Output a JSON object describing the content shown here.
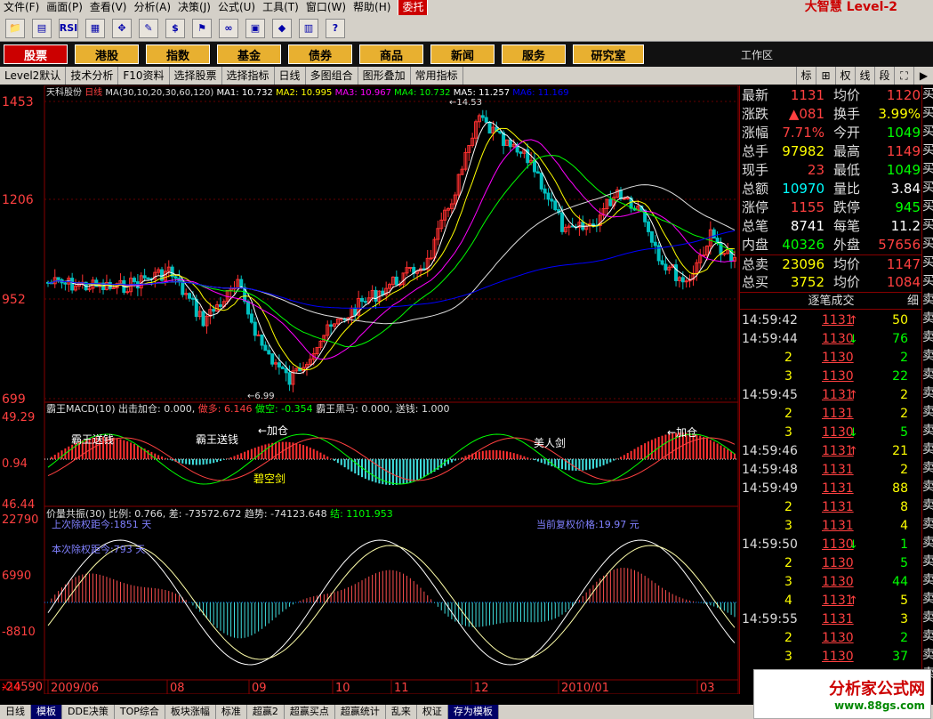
{
  "menu": [
    "文件(F)",
    "画面(P)",
    "查看(V)",
    "分析(A)",
    "决策(J)",
    "公式(U)",
    "工具(T)",
    "窗口(W)",
    "帮助(H)",
    "委托"
  ],
  "brand": "大智慧 Level-2",
  "toolbar_icons": [
    "open-icon",
    "chart-icon",
    "rsi-icon",
    "grid-icon",
    "move-icon",
    "ruler-icon",
    "dollar-icon",
    "flag-icon",
    "binoculars-icon",
    "calc-icon",
    "diamond-icon",
    "table-icon",
    "help-icon"
  ],
  "nav": [
    "股票",
    "港股",
    "指数",
    "基金",
    "债券",
    "商品",
    "新闻",
    "服务",
    "研究室"
  ],
  "workspace": "工作区",
  "tabs": [
    "Level2默认",
    "技术分析",
    "F10资料",
    "选择股票",
    "选择指标",
    "日线",
    "多图组合",
    "图形叠加",
    "常用指标"
  ],
  "right_tabs": [
    "标",
    "⊞",
    "权",
    "线",
    "段",
    "⛶",
    "▶"
  ],
  "chart": {
    "title": "天科股份",
    "period": "日线",
    "ma_params": "MA(30,10,20,30,60,120)",
    "ma": [
      {
        "label": "MA1: 10.732",
        "color": "#ffffff"
      },
      {
        "label": "MA2: 10.995",
        "color": "#ffff00"
      },
      {
        "label": "MA3: 10.967",
        "color": "#ff00ff"
      },
      {
        "label": "MA4: 10.732",
        "color": "#00ff00"
      },
      {
        "label": "MA5: 11.257",
        "color": "#ffffff"
      },
      {
        "label": "MA6: 11.169",
        "color": "#0000ff"
      }
    ],
    "price_ticks": [
      "1453",
      "1206",
      "952",
      "699"
    ],
    "high_label": "14.53",
    "low_label": "6.99",
    "macd_title": "霸王MACD(10) 出击加仓: 0.000,",
    "macd_buy": "做多: 6.146",
    "macd_sell": "做空: -0.354",
    "macd_black": "霸王黑马: 0.000,",
    "macd_send": "送钱: 1.000",
    "macd_ticks": [
      "49.29",
      "0.94",
      "46.44"
    ],
    "macd_notes": [
      "霸王送钱",
      "霸王送钱",
      "←加仓",
      "碧空剑",
      "美人剑",
      "←加仓"
    ],
    "vol_title": "价量共振(30) 比例: 0.766, 差: -73572.672",
    "vol_trend": "趋势: -74123.648",
    "vol_end": "结: 1101.953",
    "vol_ticks": [
      "22790",
      "6990",
      "-8810",
      "-24590"
    ],
    "vol_notes": [
      "上次除权距今:1851 天",
      "本次除权距今:793 天",
      "当前复权价格:19.97 元"
    ],
    "x_ticks": [
      "2009/06",
      "08",
      "09",
      "10",
      "11",
      "12",
      "2010/01",
      "03"
    ],
    "x10": "X10"
  },
  "quote": [
    {
      "l1": "最新",
      "v1": "1131",
      "c1": "#ff4040",
      "l2": "均价",
      "v2": "1120",
      "c2": "#ff4040"
    },
    {
      "l1": "涨跌",
      "v1": "▲081",
      "c1": "#ff4040",
      "l2": "换手",
      "v2": "3.99%",
      "c2": "#ffff00"
    },
    {
      "l1": "涨幅",
      "v1": "7.71%",
      "c1": "#ff4040",
      "l2": "今开",
      "v2": "1049",
      "c2": "#00ff00"
    },
    {
      "l1": "总手",
      "v1": "97982",
      "c1": "#ffff00",
      "l2": "最高",
      "v2": "1149",
      "c2": "#ff4040"
    },
    {
      "l1": "现手",
      "v1": "23",
      "c1": "#ff4040",
      "l2": "最低",
      "v2": "1049",
      "c2": "#00ff00"
    },
    {
      "l1": "总额",
      "v1": "10970",
      "c1": "#00ffff",
      "l2": "量比",
      "v2": "3.84",
      "c2": "#ffffff"
    },
    {
      "l1": "涨停",
      "v1": "1155",
      "c1": "#ff4040",
      "l2": "跌停",
      "v2": "945",
      "c2": "#00ff00"
    },
    {
      "l1": "总笔",
      "v1": "8741",
      "c1": "#ffffff",
      "l2": "每笔",
      "v2": "11.2",
      "c2": "#ffffff"
    },
    {
      "l1": "内盘",
      "v1": "40326",
      "c1": "#00ff00",
      "l2": "外盘",
      "v2": "57656",
      "c2": "#ff4040"
    },
    {
      "l1": "总卖",
      "v1": "23096",
      "c1": "#ffff00",
      "l2": "均价",
      "v2": "1147",
      "c2": "#ff4040"
    },
    {
      "l1": "总买",
      "v1": "3752",
      "c1": "#ffff00",
      "l2": "均价",
      "v2": "1084",
      "c2": "#ff4040"
    }
  ],
  "ticks_title": "逐笔成交",
  "ticks_flag": "细",
  "ticks": [
    {
      "t": "14:59:42",
      "p": "1131",
      "a": "↑",
      "v": "50",
      "pc": "#ff4040",
      "vc": "#ffff00"
    },
    {
      "t": "14:59:44",
      "p": "1130",
      "a": "↓",
      "v": "76",
      "pc": "#ff4040",
      "vc": "#00ff00"
    },
    {
      "t": "2",
      "p": "1130",
      "a": "",
      "v": "2",
      "pc": "#ff4040",
      "vc": "#00ff00"
    },
    {
      "t": "3",
      "p": "1130",
      "a": "",
      "v": "22",
      "pc": "#ff4040",
      "vc": "#00ff00"
    },
    {
      "t": "14:59:45",
      "p": "1131",
      "a": "↑",
      "v": "2",
      "pc": "#ff4040",
      "vc": "#ffff00"
    },
    {
      "t": "2",
      "p": "1131",
      "a": "",
      "v": "2",
      "pc": "#ff4040",
      "vc": "#ffff00"
    },
    {
      "t": "3",
      "p": "1130",
      "a": "↓",
      "v": "5",
      "pc": "#ff4040",
      "vc": "#00ff00"
    },
    {
      "t": "14:59:46",
      "p": "1131",
      "a": "↑",
      "v": "21",
      "pc": "#ff4040",
      "vc": "#ffff00"
    },
    {
      "t": "14:59:48",
      "p": "1131",
      "a": "",
      "v": "2",
      "pc": "#ff4040",
      "vc": "#ffff00"
    },
    {
      "t": "14:59:49",
      "p": "1131",
      "a": "",
      "v": "88",
      "pc": "#ff4040",
      "vc": "#ffff00"
    },
    {
      "t": "2",
      "p": "1131",
      "a": "",
      "v": "8",
      "pc": "#ff4040",
      "vc": "#ffff00"
    },
    {
      "t": "3",
      "p": "1131",
      "a": "",
      "v": "4",
      "pc": "#ff4040",
      "vc": "#ffff00"
    },
    {
      "t": "14:59:50",
      "p": "1130",
      "a": "↓",
      "v": "1",
      "pc": "#ff4040",
      "vc": "#00ff00"
    },
    {
      "t": "2",
      "p": "1130",
      "a": "",
      "v": "5",
      "pc": "#ff4040",
      "vc": "#00ff00"
    },
    {
      "t": "3",
      "p": "1130",
      "a": "",
      "v": "44",
      "pc": "#ff4040",
      "vc": "#00ff00"
    },
    {
      "t": "4",
      "p": "1131",
      "a": "↑",
      "v": "5",
      "pc": "#ff4040",
      "vc": "#ffff00"
    },
    {
      "t": "14:59:55",
      "p": "1131",
      "a": "",
      "v": "3",
      "pc": "#ff4040",
      "vc": "#ffff00"
    },
    {
      "t": "2",
      "p": "1130",
      "a": "",
      "v": "2",
      "pc": "#ff4040",
      "vc": "#00ff00"
    },
    {
      "t": "3",
      "p": "1130",
      "a": "",
      "v": "37",
      "pc": "#ff4040",
      "vc": "#00ff00"
    }
  ],
  "bottom": [
    "日线",
    "模板",
    "DDE决策",
    "TOP综合",
    "板块涨幅",
    "标准",
    "超赢2",
    "超赢买点",
    "超赢统计",
    "乱来",
    "权证",
    "存为模板"
  ],
  "logo": {
    "name": "分析家公式网",
    "url": "www.88gs.com"
  }
}
